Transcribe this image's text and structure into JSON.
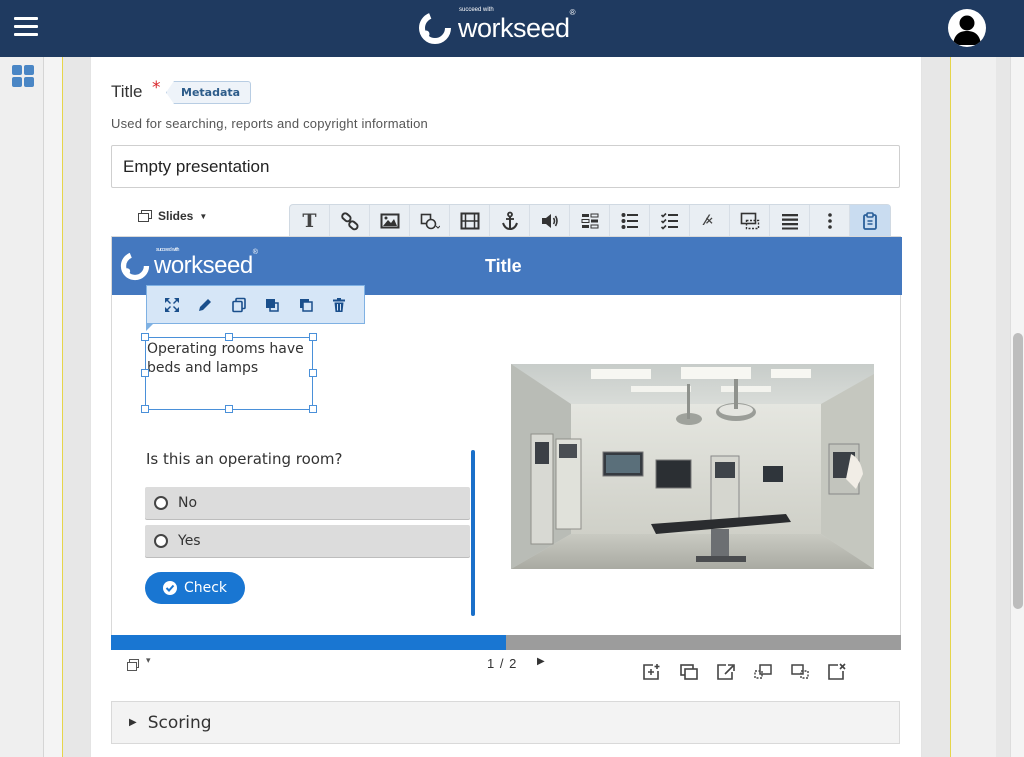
{
  "app": {
    "brand_name": "workseed",
    "brand_tagline": "succeed with",
    "brand_mark": "®",
    "accent_color": "#1f3a60",
    "primary_color": "#1976d2"
  },
  "form": {
    "title_label": "Title",
    "required_mark": "*",
    "metadata_tag": "Metadata",
    "title_help": "Used for searching, reports and copyright information",
    "title_value": "Empty presentation"
  },
  "editor": {
    "slides_label": "Slides",
    "toolbar_icons": [
      "text-icon",
      "link-icon",
      "image-icon",
      "shapes-icon",
      "video-icon",
      "anchor-icon",
      "audio-icon",
      "sort-icon",
      "single-choice-icon",
      "multi-choice-icon",
      "fraction-icon",
      "hotspot-icon",
      "list-icon",
      "more-icon",
      "clipboard-icon"
    ]
  },
  "slide": {
    "title": "Title",
    "text_box": "Operating rooms have beds and lamps",
    "question": "Is this an operating room?",
    "options": [
      {
        "label": "No"
      },
      {
        "label": "Yes"
      }
    ],
    "check_label": "Check",
    "progress": 0.5
  },
  "footer": {
    "page_counter": "1 / 2"
  },
  "sections": {
    "scoring": "Scoring"
  }
}
